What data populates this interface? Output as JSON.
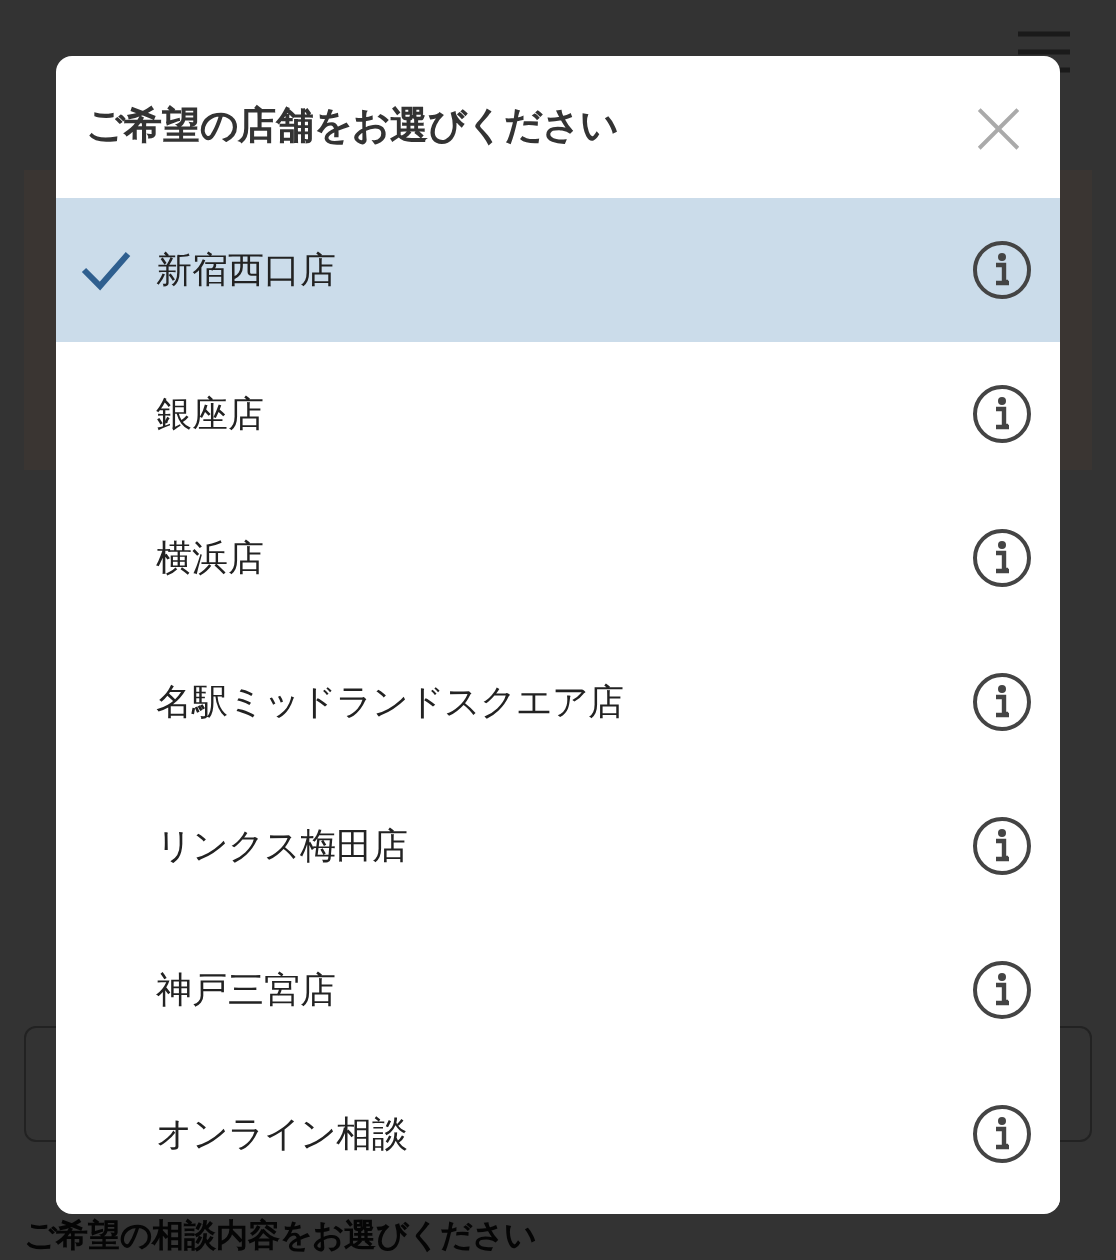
{
  "page": {
    "section_heading": "ご希望の相談内容をお選びください"
  },
  "modal": {
    "title": "ご希望の店舗をお選びください",
    "close": "×",
    "stores": [
      {
        "name": "新宿西口店",
        "selected": true
      },
      {
        "name": "銀座店",
        "selected": false
      },
      {
        "name": "横浜店",
        "selected": false
      },
      {
        "name": "名駅ミッドランドスクエア店",
        "selected": false
      },
      {
        "name": "リンクス梅田店",
        "selected": false
      },
      {
        "name": "神戸三宮店",
        "selected": false
      },
      {
        "name": "オンライン相談",
        "selected": false
      }
    ]
  }
}
